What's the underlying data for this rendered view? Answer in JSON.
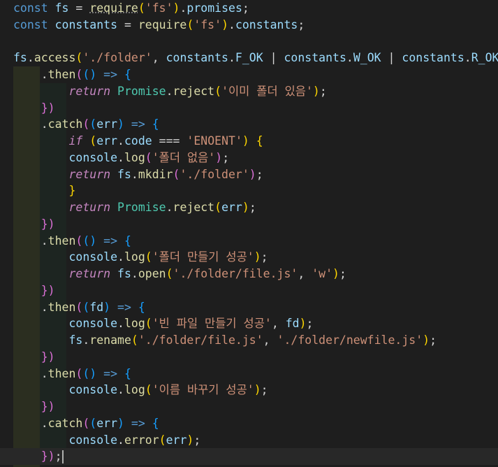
{
  "editor": {
    "lines": [
      {
        "segs": [
          [
            "kw",
            "const "
          ],
          [
            "var",
            "fs"
          ],
          [
            "op",
            " = "
          ],
          [
            "fn",
            "require"
          ],
          [
            "p1",
            "("
          ],
          [
            "str",
            "'fs'"
          ],
          [
            "p1",
            ")"
          ],
          [
            "op",
            "."
          ],
          [
            "var",
            "promises"
          ],
          [
            "op",
            ";"
          ]
        ]
      },
      {
        "segs": [
          [
            "kw",
            "const "
          ],
          [
            "var",
            "constants"
          ],
          [
            "op",
            " = "
          ],
          [
            "fn",
            "require"
          ],
          [
            "p1",
            "("
          ],
          [
            "str",
            "'fs'"
          ],
          [
            "p1",
            ")"
          ],
          [
            "op",
            "."
          ],
          [
            "var",
            "constants"
          ],
          [
            "op",
            ";"
          ]
        ]
      },
      {
        "segs": []
      },
      {
        "segs": [
          [
            "var",
            "fs"
          ],
          [
            "op",
            "."
          ],
          [
            "fn",
            "access"
          ],
          [
            "p1",
            "("
          ],
          [
            "str",
            "'./folder'"
          ],
          [
            "op",
            ", "
          ],
          [
            "var",
            "constants"
          ],
          [
            "op",
            "."
          ],
          [
            "var",
            "F_OK"
          ],
          [
            "op",
            " | "
          ],
          [
            "var",
            "constants"
          ],
          [
            "op",
            "."
          ],
          [
            "var",
            "W_OK"
          ],
          [
            "op",
            " | "
          ],
          [
            "var",
            "constants"
          ],
          [
            "op",
            "."
          ],
          [
            "var",
            "R_OK"
          ],
          [
            "p1",
            ")"
          ]
        ]
      },
      {
        "segs": [
          [
            "op",
            "    ."
          ],
          [
            "fn",
            "then"
          ],
          [
            "p2",
            "("
          ],
          [
            "p3",
            "()"
          ],
          [
            "op",
            " "
          ],
          [
            "kw",
            "=>"
          ],
          [
            "op",
            " "
          ],
          [
            "p3",
            "{"
          ]
        ]
      },
      {
        "segs": [
          [
            "op",
            "        "
          ],
          [
            "ctl",
            "return"
          ],
          [
            "op",
            " "
          ],
          [
            "cls",
            "Promise"
          ],
          [
            "op",
            "."
          ],
          [
            "fn",
            "reject"
          ],
          [
            "p1",
            "("
          ],
          [
            "str",
            "'이미 폴더 있음'"
          ],
          [
            "p1",
            ")"
          ],
          [
            "op",
            ";"
          ]
        ]
      },
      {
        "segs": [
          [
            "op",
            "    "
          ],
          [
            "p2",
            "})"
          ]
        ]
      },
      {
        "segs": [
          [
            "op",
            "    ."
          ],
          [
            "fn",
            "catch"
          ],
          [
            "p2",
            "("
          ],
          [
            "p3",
            "("
          ],
          [
            "var",
            "err"
          ],
          [
            "p3",
            ")"
          ],
          [
            "op",
            " "
          ],
          [
            "kw",
            "=>"
          ],
          [
            "op",
            " "
          ],
          [
            "p3",
            "{"
          ]
        ]
      },
      {
        "segs": [
          [
            "op",
            "        "
          ],
          [
            "ctl",
            "if"
          ],
          [
            "op",
            " "
          ],
          [
            "p1",
            "("
          ],
          [
            "var",
            "err"
          ],
          [
            "op",
            "."
          ],
          [
            "var",
            "code"
          ],
          [
            "op",
            " === "
          ],
          [
            "str",
            "'ENOENT'"
          ],
          [
            "p1",
            ")"
          ],
          [
            "op",
            " "
          ],
          [
            "p1",
            "{"
          ]
        ]
      },
      {
        "segs": [
          [
            "op",
            "        "
          ],
          [
            "var",
            "console"
          ],
          [
            "op",
            "."
          ],
          [
            "fn",
            "log"
          ],
          [
            "p2",
            "("
          ],
          [
            "str",
            "'폴더 없음'"
          ],
          [
            "p2",
            ")"
          ],
          [
            "op",
            ";"
          ]
        ]
      },
      {
        "segs": [
          [
            "op",
            "        "
          ],
          [
            "ctl",
            "return"
          ],
          [
            "op",
            " "
          ],
          [
            "var",
            "fs"
          ],
          [
            "op",
            "."
          ],
          [
            "fn",
            "mkdir"
          ],
          [
            "p2",
            "("
          ],
          [
            "str",
            "'./folder'"
          ],
          [
            "p2",
            ")"
          ],
          [
            "op",
            ";"
          ]
        ]
      },
      {
        "segs": [
          [
            "op",
            "        "
          ],
          [
            "p1",
            "}"
          ]
        ]
      },
      {
        "segs": [
          [
            "op",
            "        "
          ],
          [
            "ctl",
            "return"
          ],
          [
            "op",
            " "
          ],
          [
            "cls",
            "Promise"
          ],
          [
            "op",
            "."
          ],
          [
            "fn",
            "reject"
          ],
          [
            "p1",
            "("
          ],
          [
            "var",
            "err"
          ],
          [
            "p1",
            ")"
          ],
          [
            "op",
            ";"
          ]
        ]
      },
      {
        "segs": [
          [
            "op",
            "    "
          ],
          [
            "p2",
            "})"
          ]
        ]
      },
      {
        "segs": [
          [
            "op",
            "    ."
          ],
          [
            "fn",
            "then"
          ],
          [
            "p2",
            "("
          ],
          [
            "p3",
            "()"
          ],
          [
            "op",
            " "
          ],
          [
            "kw",
            "=>"
          ],
          [
            "op",
            " "
          ],
          [
            "p3",
            "{"
          ]
        ]
      },
      {
        "segs": [
          [
            "op",
            "        "
          ],
          [
            "var",
            "console"
          ],
          [
            "op",
            "."
          ],
          [
            "fn",
            "log"
          ],
          [
            "p1",
            "("
          ],
          [
            "str",
            "'폴더 만들기 성공'"
          ],
          [
            "p1",
            ")"
          ],
          [
            "op",
            ";"
          ]
        ]
      },
      {
        "segs": [
          [
            "op",
            "        "
          ],
          [
            "ctl",
            "return"
          ],
          [
            "op",
            " "
          ],
          [
            "var",
            "fs"
          ],
          [
            "op",
            "."
          ],
          [
            "fn",
            "open"
          ],
          [
            "p1",
            "("
          ],
          [
            "str",
            "'./folder/file.js'"
          ],
          [
            "op",
            ", "
          ],
          [
            "str",
            "'w'"
          ],
          [
            "p1",
            ")"
          ],
          [
            "op",
            ";"
          ]
        ]
      },
      {
        "segs": [
          [
            "op",
            "    "
          ],
          [
            "p2",
            "})"
          ]
        ]
      },
      {
        "segs": [
          [
            "op",
            "    ."
          ],
          [
            "fn",
            "then"
          ],
          [
            "p2",
            "("
          ],
          [
            "p3",
            "("
          ],
          [
            "var",
            "fd"
          ],
          [
            "p3",
            ")"
          ],
          [
            "op",
            " "
          ],
          [
            "kw",
            "=>"
          ],
          [
            "op",
            " "
          ],
          [
            "p3",
            "{"
          ]
        ]
      },
      {
        "segs": [
          [
            "op",
            "        "
          ],
          [
            "var",
            "console"
          ],
          [
            "op",
            "."
          ],
          [
            "fn",
            "log"
          ],
          [
            "p1",
            "("
          ],
          [
            "str",
            "'빈 파일 만들기 성공'"
          ],
          [
            "op",
            ", "
          ],
          [
            "var",
            "fd"
          ],
          [
            "p1",
            ")"
          ],
          [
            "op",
            ";"
          ]
        ]
      },
      {
        "segs": [
          [
            "op",
            "        "
          ],
          [
            "var",
            "fs"
          ],
          [
            "op",
            "."
          ],
          [
            "fn",
            "rename"
          ],
          [
            "p1",
            "("
          ],
          [
            "str",
            "'./folder/file.js'"
          ],
          [
            "op",
            ", "
          ],
          [
            "str",
            "'./folder/newfile.js'"
          ],
          [
            "p1",
            ")"
          ],
          [
            "op",
            ";"
          ]
        ]
      },
      {
        "segs": [
          [
            "op",
            "    "
          ],
          [
            "p2",
            "})"
          ]
        ]
      },
      {
        "segs": [
          [
            "op",
            "    ."
          ],
          [
            "fn",
            "then"
          ],
          [
            "p2",
            "("
          ],
          [
            "p3",
            "()"
          ],
          [
            "op",
            " "
          ],
          [
            "kw",
            "=>"
          ],
          [
            "op",
            " "
          ],
          [
            "p3",
            "{"
          ]
        ]
      },
      {
        "segs": [
          [
            "op",
            "        "
          ],
          [
            "var",
            "console"
          ],
          [
            "op",
            "."
          ],
          [
            "fn",
            "log"
          ],
          [
            "p1",
            "("
          ],
          [
            "str",
            "'이름 바꾸기 성공'"
          ],
          [
            "p1",
            ")"
          ],
          [
            "op",
            ";"
          ]
        ]
      },
      {
        "segs": [
          [
            "op",
            "    "
          ],
          [
            "p2",
            "})"
          ]
        ]
      },
      {
        "segs": [
          [
            "op",
            "    ."
          ],
          [
            "fn",
            "catch"
          ],
          [
            "p2",
            "("
          ],
          [
            "p3",
            "("
          ],
          [
            "var",
            "err"
          ],
          [
            "p3",
            ")"
          ],
          [
            "op",
            " "
          ],
          [
            "kw",
            "=>"
          ],
          [
            "op",
            " "
          ],
          [
            "p3",
            "{"
          ]
        ]
      },
      {
        "segs": [
          [
            "op",
            "        "
          ],
          [
            "var",
            "console"
          ],
          [
            "op",
            "."
          ],
          [
            "fn",
            "error"
          ],
          [
            "p1",
            "("
          ],
          [
            "var",
            "err"
          ],
          [
            "p1",
            ")"
          ],
          [
            "op",
            ";"
          ]
        ]
      },
      {
        "segs": [
          [
            "op",
            "    "
          ],
          [
            "p2",
            "})"
          ],
          [
            "op",
            ";"
          ]
        ],
        "caret": true
      }
    ]
  }
}
